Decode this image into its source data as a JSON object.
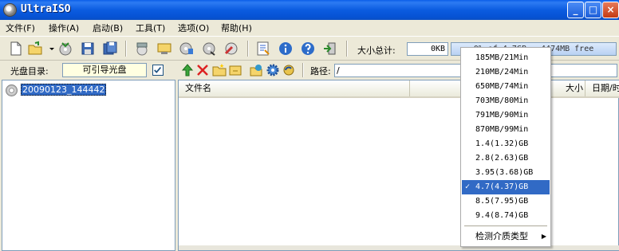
{
  "window": {
    "title": "UltraISO"
  },
  "menu": [
    "文件(F)",
    "操作(A)",
    "启动(B)",
    "工具(T)",
    "选项(O)",
    "帮助(H)"
  ],
  "toolbar": {
    "size_label": "大小总计:",
    "size_value": "0KB",
    "capacity_text": "0% of 4.7GB - 4474MB free"
  },
  "bar2": {
    "disc_dir_label": "光盘目录:",
    "boot_type": "可引导光盘",
    "path_label": "路径:",
    "path_value": "/"
  },
  "tree": {
    "root_label": "20090123_144442"
  },
  "file_list": {
    "columns": [
      "文件名",
      "大小",
      "日期/时"
    ]
  },
  "dropdown": {
    "items": [
      "185MB/21Min",
      "210MB/24Min",
      "650MB/74Min",
      "703MB/80Min",
      "791MB/90Min",
      "870MB/99Min",
      "1.4(1.32)GB",
      "2.8(2.63)GB",
      "3.95(3.68)GB",
      "4.7(4.37)GB",
      "8.5(7.95)GB",
      "9.4(8.74)GB"
    ],
    "selected_index": 9,
    "detect_label": "检测介质类型",
    "check_glyph": "✓",
    "arrow_glyph": "▶"
  },
  "colors": {
    "titlebar": "#0a5ee8",
    "selection": "#316ac5",
    "window_bg": "#ece9d8"
  }
}
